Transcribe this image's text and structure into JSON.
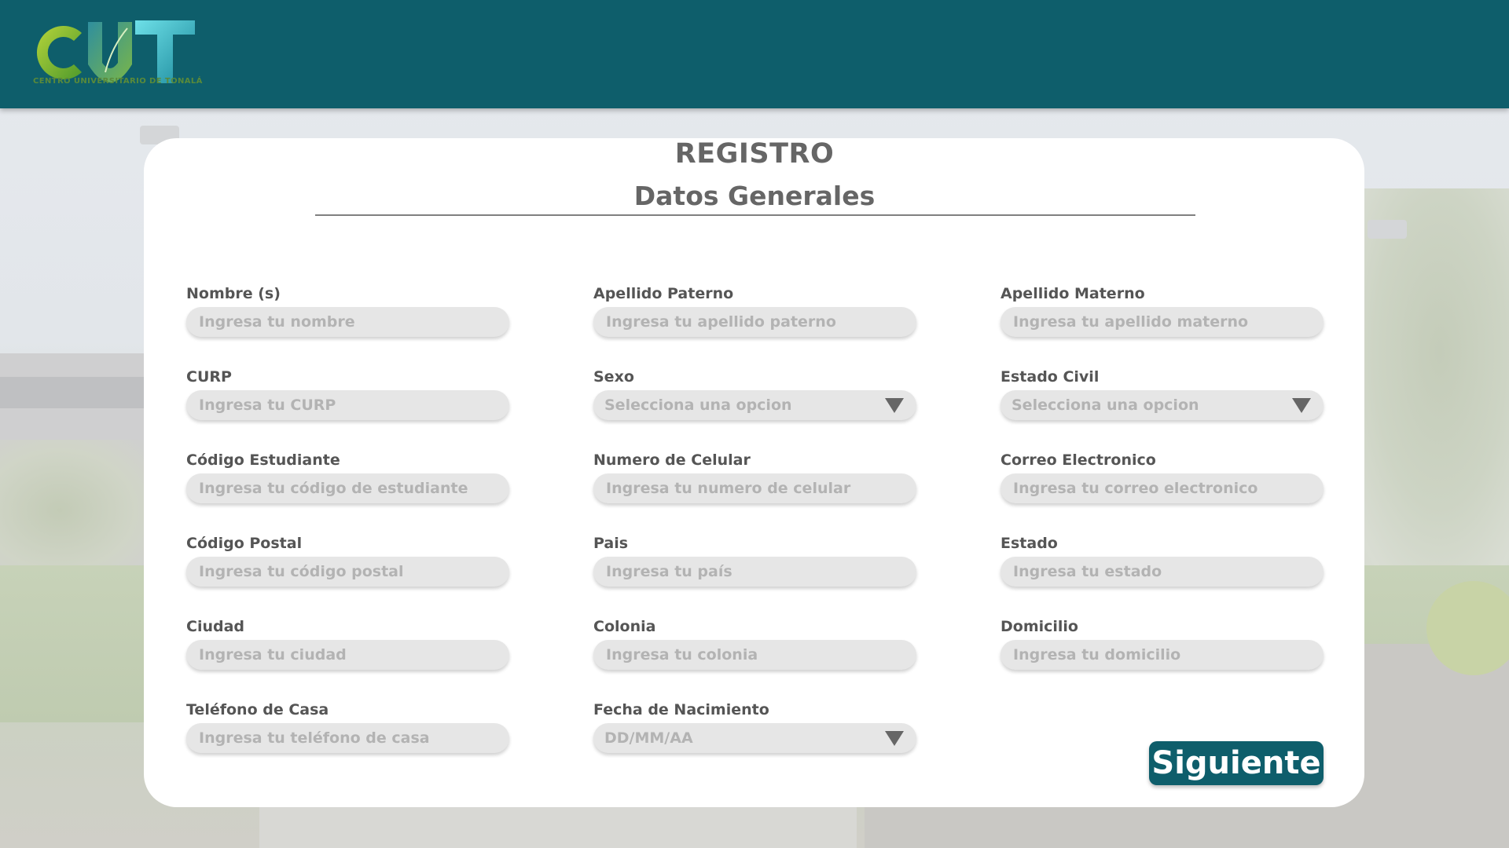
{
  "header": {
    "logo_text": "CUT",
    "logo_caption": "CENTRO UNIVERSITARIO DE TONALÁ",
    "background_color": "#0e5e6b"
  },
  "form": {
    "title": "REGISTRO",
    "subtitle": "Datos Generales",
    "fields": {
      "nombre": {
        "label": "Nombre (s)",
        "placeholder": "Ingresa tu nombre"
      },
      "apellido_paterno": {
        "label": "Apellido Paterno",
        "placeholder": "Ingresa tu apellido paterno"
      },
      "apellido_materno": {
        "label": "Apellido Materno",
        "placeholder": "Ingresa tu apellido materno"
      },
      "curp": {
        "label": "CURP",
        "placeholder": "Ingresa tu CURP"
      },
      "sexo": {
        "label": "Sexo",
        "placeholder": "Selecciona una opcion"
      },
      "estado_civil": {
        "label": "Estado Civil",
        "placeholder": "Selecciona una opcion"
      },
      "codigo_estudiante": {
        "label": "Código Estudiante",
        "placeholder": "Ingresa tu código de estudiante"
      },
      "celular": {
        "label": "Numero de Celular",
        "placeholder": "Ingresa tu numero de celular"
      },
      "correo": {
        "label": "Correo Electronico",
        "placeholder": "Ingresa tu correo electronico"
      },
      "codigo_postal": {
        "label": "Código Postal",
        "placeholder": "Ingresa tu código postal"
      },
      "pais": {
        "label": "Pais",
        "placeholder": "Ingresa tu país"
      },
      "estado": {
        "label": "Estado",
        "placeholder": "Ingresa tu estado"
      },
      "ciudad": {
        "label": "Ciudad",
        "placeholder": "Ingresa tu ciudad"
      },
      "colonia": {
        "label": "Colonia",
        "placeholder": "Ingresa tu colonia"
      },
      "domicilio": {
        "label": "Domicilio",
        "placeholder": "Ingresa tu domicilio"
      },
      "telefono_casa": {
        "label": "Teléfono de Casa",
        "placeholder": "Ingresa tu teléfono de casa"
      },
      "fecha_nacimiento": {
        "label": "Fecha de Nacimiento",
        "placeholder": "DD/MM/AA"
      }
    },
    "next_button": "Siguiente"
  },
  "colors": {
    "accent": "#0e5e6b",
    "input_bg": "#e6e6e6",
    "label_text": "#555555",
    "placeholder_text": "#b3b3b3"
  },
  "icons": {
    "dropdown": "triangle-down-icon"
  }
}
